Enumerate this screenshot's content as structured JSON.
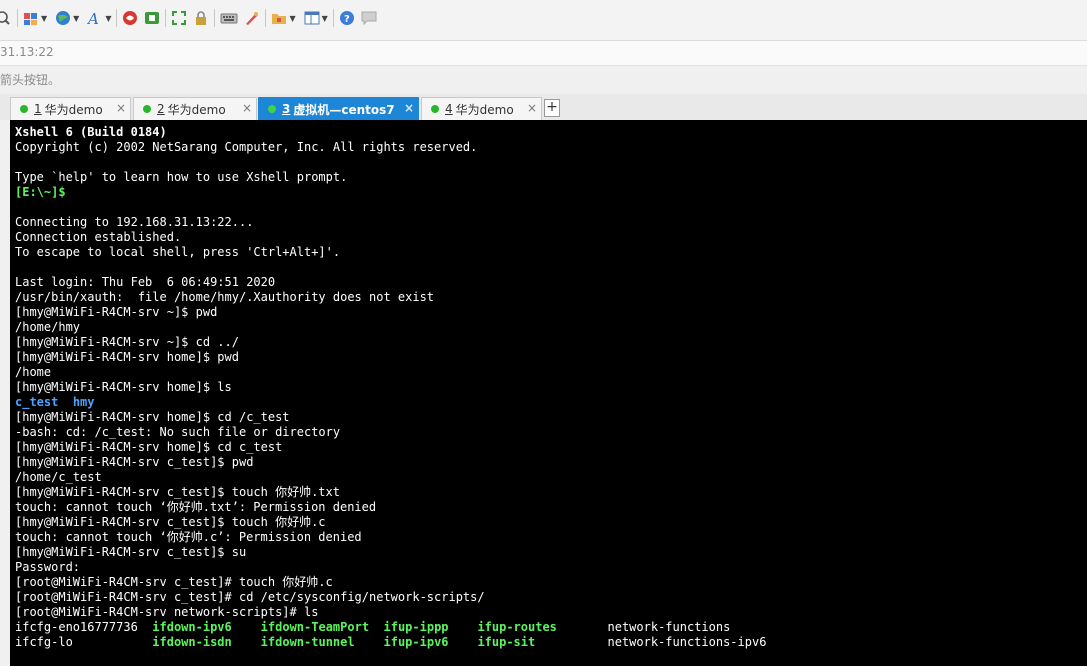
{
  "toolbar": {
    "icons": [
      "search-icon",
      "new-session-icon",
      "globe-icon",
      "font-icon",
      "xftp-icon",
      "xmanager-icon",
      "fullscreen-icon",
      "lock-icon",
      "keyboard-icon",
      "script-icon",
      "folder-icon",
      "layout-icon",
      "help-icon",
      "chat-icon"
    ]
  },
  "address": {
    "text": "31.13:22"
  },
  "hint": {
    "text": "箭头按钮。"
  },
  "tabs": [
    {
      "num": "1",
      "label": "华为demo",
      "close": "×",
      "active": false
    },
    {
      "num": "2",
      "label": "华为demo",
      "close": "×",
      "active": false
    },
    {
      "num": "3",
      "label": "虚拟机—centos7",
      "close": "×",
      "active": true
    },
    {
      "num": "4",
      "label": "华为demo",
      "close": "×",
      "active": false
    }
  ],
  "add_tab": "+",
  "colors": {
    "tab_active": "#1e86d6",
    "status_dot": "#2bb52b",
    "dir_blue": "#4aa3ff",
    "exec_green": "#5cf45c"
  },
  "terminal": {
    "lines": [
      [
        {
          "t": "Xshell 6 (Build 0184)",
          "s": "bold"
        }
      ],
      [
        {
          "t": "Copyright (c) 2002 NetSarang Computer, Inc. All rights reserved."
        }
      ],
      [
        {
          "t": ""
        }
      ],
      [
        {
          "t": "Type `help' to learn how to use Xshell prompt."
        }
      ],
      [
        {
          "t": "[E:\\~]$",
          "s": "green"
        }
      ],
      [
        {
          "t": ""
        }
      ],
      [
        {
          "t": "Connecting to 192.168.31.13:22..."
        }
      ],
      [
        {
          "t": "Connection established."
        }
      ],
      [
        {
          "t": "To escape to local shell, press 'Ctrl+Alt+]'."
        }
      ],
      [
        {
          "t": ""
        }
      ],
      [
        {
          "t": "Last login: Thu Feb  6 06:49:51 2020"
        }
      ],
      [
        {
          "t": "/usr/bin/xauth:  file /home/hmy/.Xauthority does not exist"
        }
      ],
      [
        {
          "t": "[hmy@MiWiFi-R4CM-srv ~]$ pwd"
        }
      ],
      [
        {
          "t": "/home/hmy"
        }
      ],
      [
        {
          "t": "[hmy@MiWiFi-R4CM-srv ~]$ cd ../"
        }
      ],
      [
        {
          "t": "[hmy@MiWiFi-R4CM-srv home]$ pwd"
        }
      ],
      [
        {
          "t": "/home"
        }
      ],
      [
        {
          "t": "[hmy@MiWiFi-R4CM-srv home]$ ls"
        }
      ],
      [
        {
          "t": "c_test",
          "s": "cyan"
        },
        {
          "t": "  "
        },
        {
          "t": "hmy",
          "s": "cyan"
        }
      ],
      [
        {
          "t": "[hmy@MiWiFi-R4CM-srv home]$ cd /c_test"
        }
      ],
      [
        {
          "t": "-bash: cd: /c_test: No such file or directory"
        }
      ],
      [
        {
          "t": "[hmy@MiWiFi-R4CM-srv home]$ cd c_test"
        }
      ],
      [
        {
          "t": "[hmy@MiWiFi-R4CM-srv c_test]$ pwd"
        }
      ],
      [
        {
          "t": "/home/c_test"
        }
      ],
      [
        {
          "t": "[hmy@MiWiFi-R4CM-srv c_test]$ touch 你好帅.txt"
        }
      ],
      [
        {
          "t": "touch: cannot touch ‘你好帅.txt’: Permission denied"
        }
      ],
      [
        {
          "t": "[hmy@MiWiFi-R4CM-srv c_test]$ touch 你好帅.c"
        }
      ],
      [
        {
          "t": "touch: cannot touch ‘你好帅.c’: Permission denied"
        }
      ],
      [
        {
          "t": "[hmy@MiWiFi-R4CM-srv c_test]$ su"
        }
      ],
      [
        {
          "t": "Password:"
        }
      ],
      [
        {
          "t": "[root@MiWiFi-R4CM-srv c_test]# touch 你好帅.c"
        }
      ],
      [
        {
          "t": "[root@MiWiFi-R4CM-srv c_test]# cd /etc/sysconfig/network-scripts/"
        }
      ],
      [
        {
          "t": "[root@MiWiFi-R4CM-srv network-scripts]# ls"
        }
      ],
      [
        {
          "t": "ifcfg-eno16777736  "
        },
        {
          "t": "ifdown-ipv6",
          "s": "bgreen"
        },
        {
          "t": "    "
        },
        {
          "t": "ifdown-TeamPort",
          "s": "bgreen"
        },
        {
          "t": "  "
        },
        {
          "t": "ifup-ippp",
          "s": "bgreen"
        },
        {
          "t": "    "
        },
        {
          "t": "ifup-routes",
          "s": "bgreen"
        },
        {
          "t": "       network-functions"
        }
      ],
      [
        {
          "t": "ifcfg-lo           "
        },
        {
          "t": "ifdown-isdn",
          "s": "bgreen"
        },
        {
          "t": "    "
        },
        {
          "t": "ifdown-tunnel",
          "s": "bgreen"
        },
        {
          "t": "    "
        },
        {
          "t": "ifup-ipv6",
          "s": "bgreen"
        },
        {
          "t": "    "
        },
        {
          "t": "ifup-sit",
          "s": "bgreen"
        },
        {
          "t": "          network-functions-ipv6"
        }
      ]
    ]
  }
}
